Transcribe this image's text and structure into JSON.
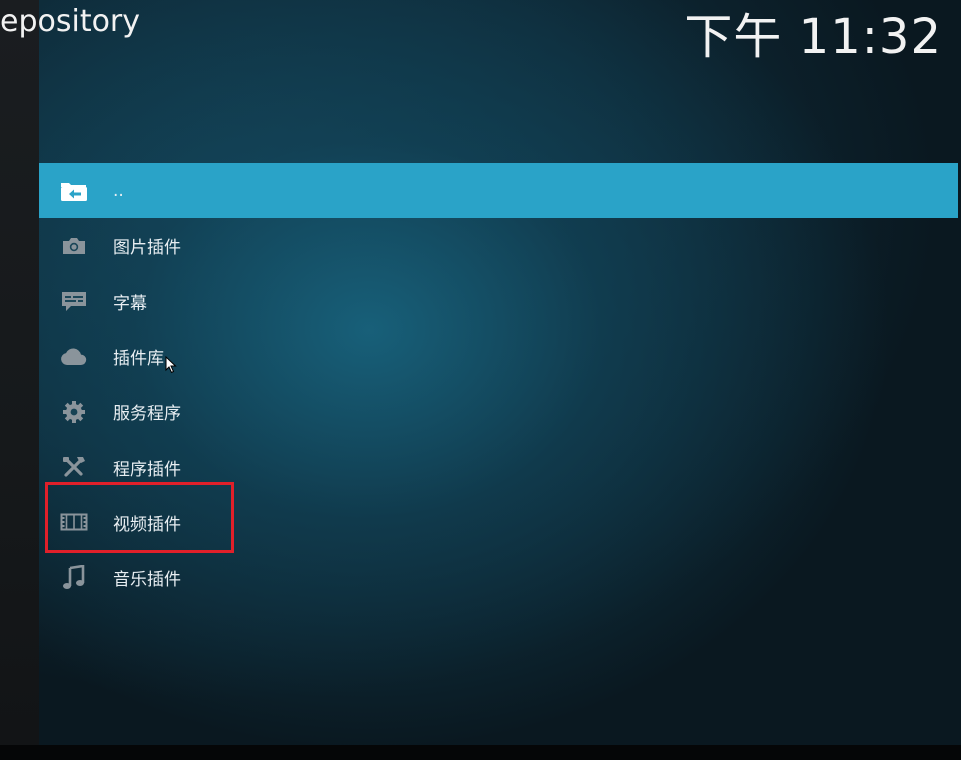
{
  "header": {
    "title": "epository",
    "clock": "下午 11:32"
  },
  "menu": {
    "items": [
      {
        "label": "..",
        "icon": "folder-back-icon",
        "selected": true
      },
      {
        "label": "图片插件",
        "icon": "camera-icon",
        "selected": false
      },
      {
        "label": "字幕",
        "icon": "subtitles-icon",
        "selected": false
      },
      {
        "label": "插件库",
        "icon": "cloud-icon",
        "selected": false
      },
      {
        "label": "服务程序",
        "icon": "gear-icon",
        "selected": false
      },
      {
        "label": "程序插件",
        "icon": "tools-icon",
        "selected": false
      },
      {
        "label": "视频插件",
        "icon": "film-icon",
        "selected": false
      },
      {
        "label": "音乐插件",
        "icon": "music-note-icon",
        "selected": false
      }
    ]
  },
  "colors": {
    "selected_row": "#2aa3c8",
    "highlight_box": "#e0202a"
  }
}
